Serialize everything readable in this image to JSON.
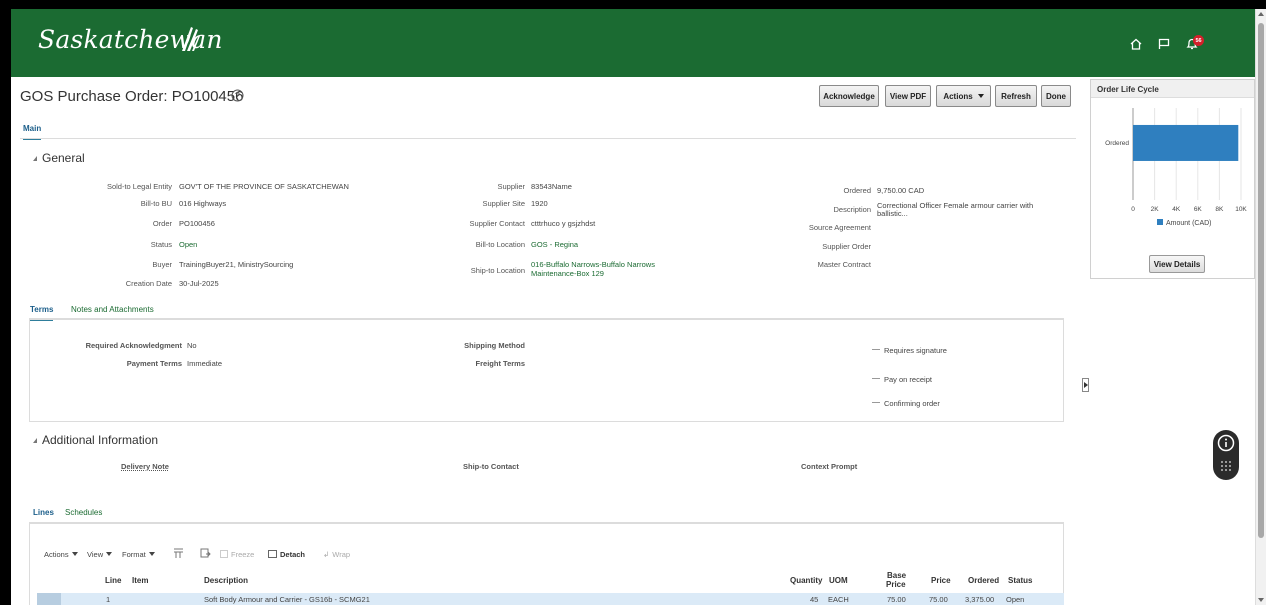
{
  "header": {
    "logo_text": "Saskatchewan",
    "notification_count": "56",
    "brand_color": "#1b6b32"
  },
  "page": {
    "title": "GOS Purchase Order: PO100456"
  },
  "buttons": {
    "acknowledge": "Acknowledge",
    "view_pdf": "View PDF",
    "actions": "Actions",
    "refresh": "Refresh",
    "done": "Done"
  },
  "tabs": {
    "main": "Main"
  },
  "general": {
    "heading": "General",
    "col1": [
      {
        "label": "Sold-to Legal Entity",
        "value": "GOV'T OF THE PROVINCE OF SASKATCHEWAN"
      },
      {
        "label": "Bill-to BU",
        "value": "016 Highways"
      },
      {
        "label": "Order",
        "value": "PO100456"
      },
      {
        "label": "Status",
        "value": "Open"
      },
      {
        "label": "Buyer",
        "value": "TrainingBuyer21, MinistrySourcing"
      },
      {
        "label": "Creation Date",
        "value": "30-Jul-2025"
      }
    ],
    "col2": [
      {
        "label": "Supplier",
        "value": "83543Name"
      },
      {
        "label": "Supplier Site",
        "value": "1920"
      },
      {
        "label": "Supplier Contact",
        "value": "ctttrhuco y gsjzhdst"
      },
      {
        "label": "Bill-to Location",
        "value": "GOS - Regina"
      },
      {
        "label": "Ship-to Location",
        "value": "016-Buffalo Narrows-Buffalo Narrows",
        "value2": "Maintenance-Box 129"
      }
    ],
    "col3": [
      {
        "label": "Ordered",
        "value": "9,750.00 CAD"
      },
      {
        "label": "Description",
        "value": "Correctional Officer Female armour carrier with",
        "value2": "ballistic..."
      },
      {
        "label": "Source Agreement",
        "value": ""
      },
      {
        "label": "Supplier Order",
        "value": ""
      },
      {
        "label": "Master Contract",
        "value": ""
      }
    ]
  },
  "terms": {
    "tab_terms": "Terms",
    "tab_notes": "Notes and Attachments",
    "required_ack_label": "Required Acknowledgment",
    "required_ack_value": "No",
    "payment_terms_label": "Payment Terms",
    "payment_terms_value": "Immediate",
    "shipping_method_label": "Shipping Method",
    "freight_terms_label": "Freight Terms",
    "flags": [
      "Requires signature",
      "Pay on receipt",
      "Confirming order"
    ]
  },
  "additional": {
    "heading": "Additional Information",
    "delivery_note": "Delivery Note",
    "ship_to_contact": "Ship-to Contact",
    "context_prompt": "Context Prompt"
  },
  "lines": {
    "tab_lines": "Lines",
    "tab_schedules": "Schedules",
    "toolbar": {
      "actions": "Actions",
      "view": "View",
      "format": "Format",
      "freeze": "Freeze",
      "detach": "Detach",
      "wrap": "Wrap"
    },
    "columns": {
      "line": "Line",
      "item": "Item",
      "description": "Description",
      "quantity": "Quantity",
      "uom": "UOM",
      "base_price_1": "Base",
      "base_price_2": "Price",
      "price": "Price",
      "ordered": "Ordered",
      "status": "Status"
    },
    "rows": [
      {
        "line": "1",
        "item": "",
        "description": "Soft Body Armour and Carrier - GS16b - SCMG21",
        "quantity": "45",
        "uom": "EACH",
        "base_price": "75.00",
        "price": "75.00",
        "ordered": "3,375.00",
        "status": "Open"
      }
    ]
  },
  "lifecycle": {
    "heading": "Order Life Cycle",
    "view_details": "View Details"
  },
  "chart_data": {
    "type": "bar",
    "orientation": "horizontal",
    "categories": [
      "Ordered"
    ],
    "series": [
      {
        "name": "Amount (CAD)",
        "values": [
          9750
        ]
      }
    ],
    "x_ticks": [
      "0",
      "2K",
      "4K",
      "6K",
      "8K",
      "10K"
    ],
    "xlim": [
      0,
      10000
    ],
    "bar_color": "#2f7fbf",
    "legend_position": "bottom"
  }
}
